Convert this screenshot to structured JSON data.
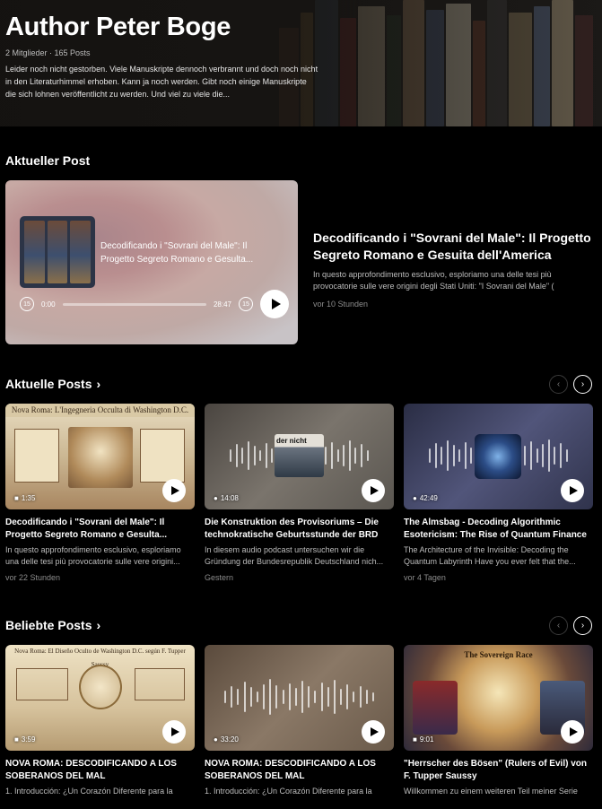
{
  "hero": {
    "title": "Author Peter Boge",
    "meta": "2 Mitglieder  ·  165 Posts",
    "description": "Leider noch nicht gestorben. Viele Manuskripte dennoch verbrannt und doch noch nicht in den Literaturhimmel erhoben. Kann ja noch werden. Gibt noch einige Manuskripte die sich lohnen veröffentlicht zu werden. Und viel zu viele die..."
  },
  "featured": {
    "section_title": "Aktueller Post",
    "card_title": "Decodificando i \"Sovrani del Male\": Il Progetto Segreto Romano e Gesulta...",
    "time_start": "0:00",
    "time_end": "28:47",
    "skip_back": "15",
    "skip_forward": "15",
    "title": "Decodificando i \"Sovrani del Male\": Il Progetto Segreto Romano e Gesuita dell'America",
    "description": "In questo approfondimento esclusivo, esploriamo una delle tesi più provocatorie sulle vere origini degli Stati Uniti: \"I Sovrani del Male\" (",
    "time_ago": "vor 10 Stunden"
  },
  "recent": {
    "section_title": "Aktuelle Posts",
    "chevron": "›",
    "prev": "‹",
    "next": "›",
    "cards": [
      {
        "duration": "1:35",
        "media": "video",
        "title": "Decodificando i \"Sovrani del Male\": Il Progetto Segreto Romano e Gesulta...",
        "description": "In questo approfondimento esclusivo, esploriamo una delle tesi più provocatorie sulle vere origini...",
        "time": "vor 22 Stunden",
        "overlay_text": "Nova Roma: L'Ingegneria Occulta di Washington D.C."
      },
      {
        "duration": "14:08",
        "media": "audio",
        "title": "Die Konstruktion des Provisoriums – Die technokratische Geburtsstunde der BRD",
        "description": "In diesem audio podcast untersuchen wir die Gründung der Bundesrepublik Deutschland nich...",
        "time": "Gestern",
        "overlay_text": "der nicht"
      },
      {
        "duration": "42:49",
        "media": "audio",
        "title": "The Almsbag - Decoding Algorithmic Esotericism: The Rise of Quantum Finance",
        "description": "The Architecture of the Invisible: Decoding the Quantum Labyrinth Have you ever felt that the...",
        "time": "vor 4 Tagen"
      }
    ]
  },
  "popular": {
    "section_title": "Beliebte Posts",
    "chevron": "›",
    "prev": "‹",
    "next": "›",
    "cards": [
      {
        "duration": "3:59",
        "media": "video",
        "title": "NOVA ROMA: DESCODIFICANDO A LOS SOBERANOS DEL MAL",
        "description": "1. Introducción: ¿Un Corazón Diferente para la",
        "overlay_text": "Nova Roma: El Diseño Oculto de Washington D.C. según F. Tupper Saussy"
      },
      {
        "duration": "33:20",
        "media": "audio",
        "title": "NOVA ROMA: DESCODIFICANDO A LOS SOBERANOS DEL MAL",
        "description": "1. Introducción: ¿Un Corazón Diferente para la"
      },
      {
        "duration": "9:01",
        "media": "video",
        "title": "\"Herrscher des Bösen\" (Rulers of Evil) von F. Tupper Saussy",
        "description": "Willkommen zu einem weiteren Teil meiner Serie",
        "overlay_text": "The Sovereign Race"
      }
    ]
  },
  "colors": {
    "background": "#000000",
    "text_muted": "#bdbdbd",
    "text_dim": "#8c8c8c"
  }
}
